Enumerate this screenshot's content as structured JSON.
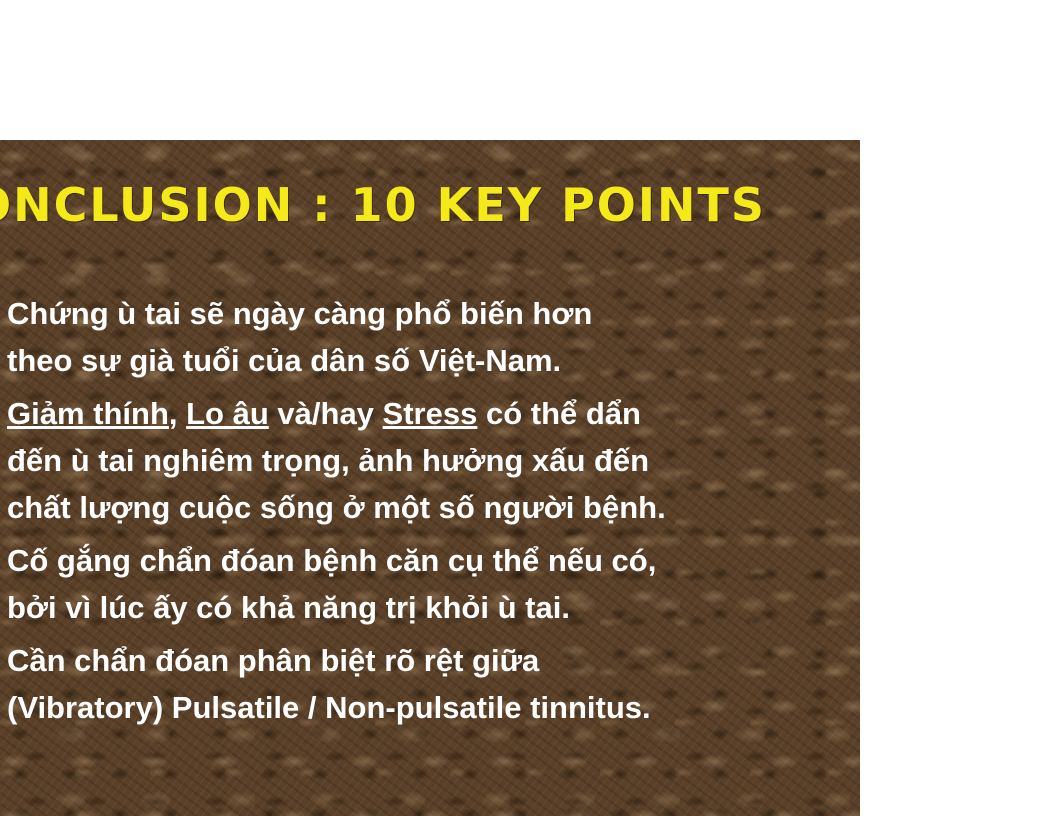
{
  "slide": {
    "title": "ONCLUSION : 10 KEY POINTS",
    "points": [
      {
        "line1": "Chứng ù tai sẽ ngày càng phổ biến hơn",
        "line2": "theo sự già tuổi của dân số Việt-Nam."
      },
      {
        "term1": "Giảm thính",
        "sep1": ", ",
        "term2": "Lo âu",
        "sep2": " và/hay ",
        "term3": "Stress",
        "rest1": " có thể dẩn",
        "line2": "đến ù tai nghiêm trọng, ảnh hưởng xấu đến",
        "line3": "chất lượng cuộc sống ở một số người bệnh."
      },
      {
        "line1": "Cố gắng chẩn đóan bệnh căn cụ thể nếu có,",
        "line2": "bởi vì lúc ấy có khả năng trị khỏi ù tai."
      },
      {
        "line1": "Cần chẩn đóan phân biệt rõ rệt giữa",
        "line2": "(Vibratory) Pulsatile / Non-pulsatile tinnitus."
      }
    ]
  },
  "colors": {
    "title": "#f4ea1a",
    "text": "#ffffff",
    "background": "#5a4028"
  }
}
